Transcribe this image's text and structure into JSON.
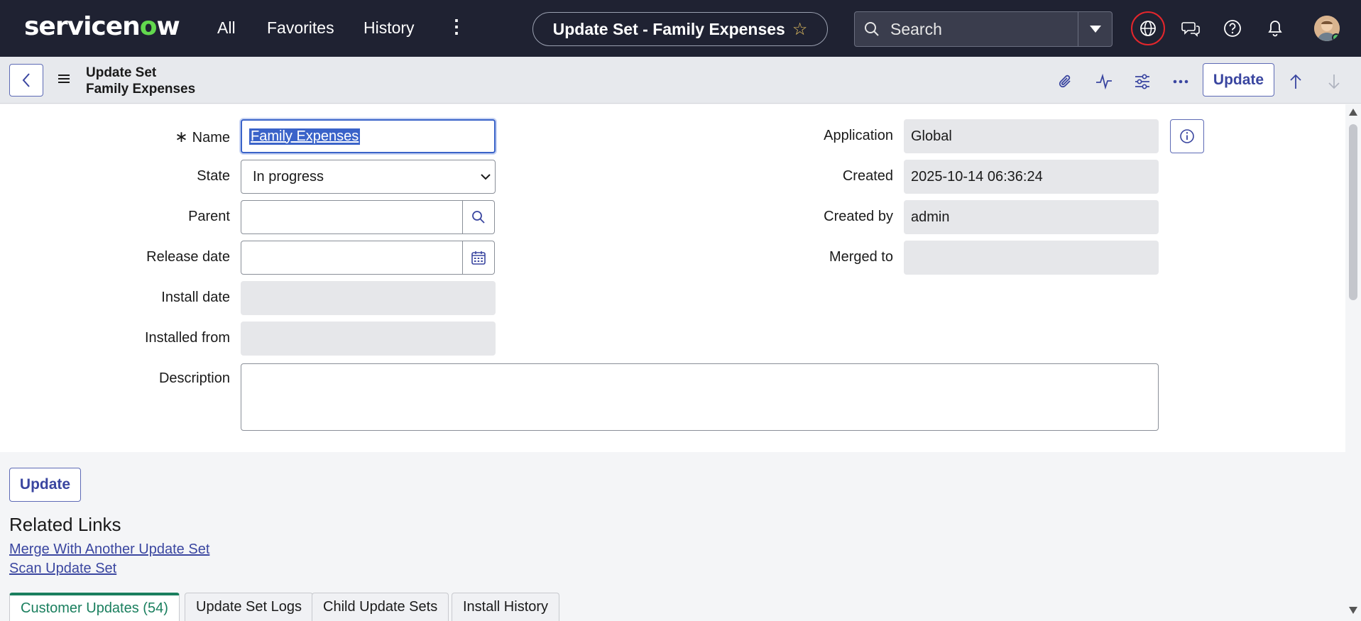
{
  "header": {
    "logo": {
      "pre": "servicen",
      "o": "o",
      "post": "w"
    },
    "nav": [
      "All",
      "Favorites",
      "History"
    ],
    "title": "Update Set - Family Expenses",
    "search_placeholder": "Search",
    "icons": [
      "globe-icon",
      "chat-icon",
      "help-icon",
      "bell-icon",
      "avatar"
    ]
  },
  "subheader": {
    "record_type": "Update Set",
    "record_name": "Family Expenses",
    "update_label": "Update"
  },
  "form": {
    "left": {
      "name_label": "Name",
      "name_value": "Family Expenses",
      "state_label": "State",
      "state_value": "In progress",
      "parent_label": "Parent",
      "parent_value": "",
      "release_date_label": "Release date",
      "release_date_value": "",
      "install_date_label": "Install date",
      "install_date_value": "",
      "installed_from_label": "Installed from",
      "installed_from_value": ""
    },
    "right": {
      "application_label": "Application",
      "application_value": "Global",
      "created_label": "Created",
      "created_value": "2025-10-14 06:36:24",
      "created_by_label": "Created by",
      "created_by_value": "admin",
      "merged_to_label": "Merged to",
      "merged_to_value": ""
    },
    "description_label": "Description",
    "description_value": ""
  },
  "bottom": {
    "update_label": "Update",
    "related_links_title": "Related Links",
    "links": [
      "Merge With Another Update Set",
      "Scan Update Set"
    ]
  },
  "tabs": [
    "Customer Updates (54)",
    "Update Set Logs",
    "Child Update Sets",
    "Install History"
  ],
  "colors": {
    "topbar": "#1f2232",
    "accent": "#3a46a0",
    "active_tab": "#1a7f5e",
    "brand_green": "#62d84e"
  }
}
